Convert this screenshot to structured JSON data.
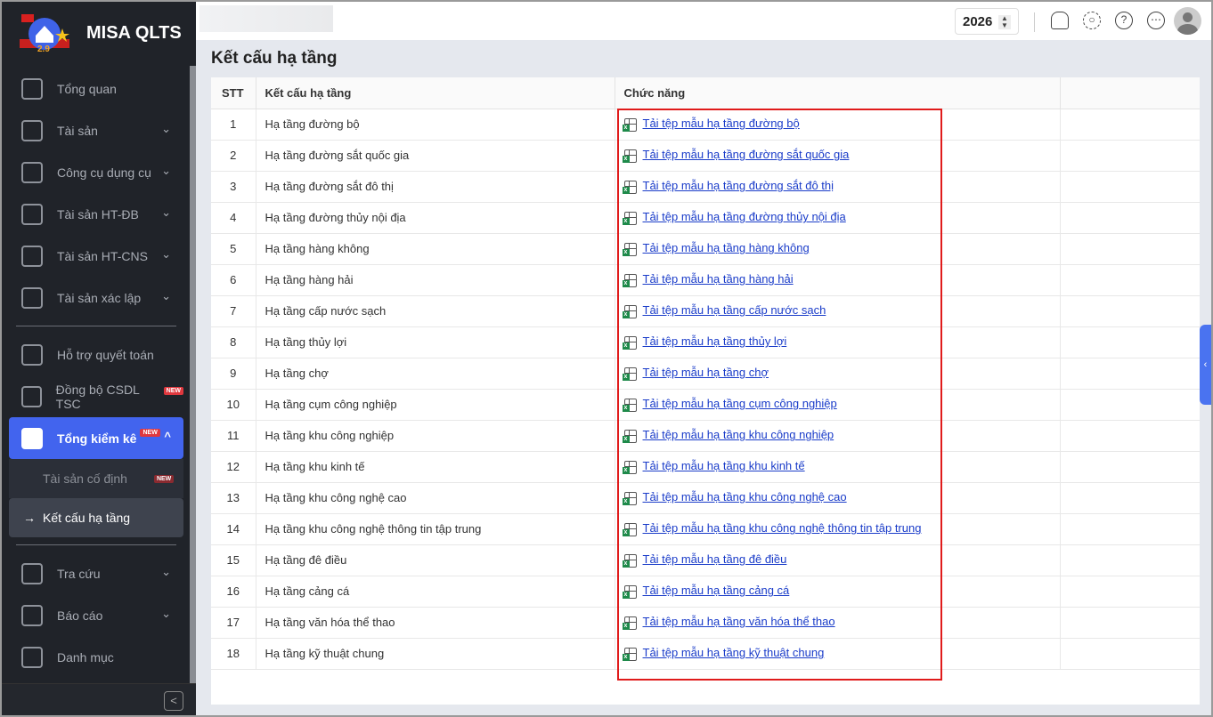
{
  "app": {
    "name": "MISA QLTS",
    "year": "2026"
  },
  "sidebar": {
    "items": [
      {
        "label": "Tổng quan",
        "chev": false
      },
      {
        "label": "Tài sản",
        "chev": true
      },
      {
        "label": "Công cụ dụng cụ",
        "chev": true
      },
      {
        "label": "Tài sản HT-ĐB",
        "chev": true
      },
      {
        "label": "Tài sản HT-CNS",
        "chev": true
      },
      {
        "label": "Tài sản xác lập",
        "chev": true
      }
    ],
    "items2": [
      {
        "label": "Hỗ trợ quyết toán"
      },
      {
        "label": "Đồng bộ CSDL TSC",
        "badge": "NEW"
      }
    ],
    "active": {
      "label": "Tổng kiểm kê",
      "badge": "NEW"
    },
    "sub": [
      {
        "label": "Tài sản cố định",
        "badge": "NEW"
      },
      {
        "label": "Kết cấu hạ tầng",
        "arrow": "→"
      }
    ],
    "items3": [
      {
        "label": "Tra cứu",
        "chev": true
      },
      {
        "label": "Báo cáo",
        "chev": true
      },
      {
        "label": "Danh mục",
        "chev": false
      }
    ]
  },
  "page": {
    "title": "Kết cấu hạ tầng"
  },
  "table": {
    "headers": [
      "STT",
      "Kết cấu hạ tầng",
      "Chức năng"
    ],
    "rows": [
      [
        "1",
        "Hạ tầng đường bộ",
        "Tải tệp mẫu hạ tầng đường bộ"
      ],
      [
        "2",
        "Hạ tầng đường sắt quốc gia",
        "Tải tệp mẫu hạ tầng đường sắt quốc gia"
      ],
      [
        "3",
        "Hạ tầng đường sắt đô thị",
        "Tải tệp mẫu hạ tầng đường sắt đô thị"
      ],
      [
        "4",
        "Hạ tầng đường thủy nội địa",
        "Tải tệp mẫu hạ tầng đường thủy nội địa"
      ],
      [
        "5",
        "Hạ tầng hàng không",
        "Tải tệp mẫu hạ tầng hàng không"
      ],
      [
        "6",
        "Hạ tầng hàng hải",
        "Tải tệp mẫu hạ tầng hàng hải"
      ],
      [
        "7",
        "Hạ tầng cấp nước sạch",
        "Tải tệp mẫu hạ tầng cấp nước sạch"
      ],
      [
        "8",
        "Hạ tầng thủy lợi",
        "Tải tệp mẫu hạ tầng thủy lợi"
      ],
      [
        "9",
        "Hạ tầng chợ",
        "Tải tệp mẫu hạ tầng chợ"
      ],
      [
        "10",
        "Hạ tầng cụm công nghiệp",
        "Tải tệp mẫu hạ tầng cụm công nghiệp"
      ],
      [
        "11",
        "Hạ tầng khu công nghiệp",
        "Tải tệp mẫu hạ tầng khu công nghiệp"
      ],
      [
        "12",
        "Hạ tầng khu kinh tế",
        "Tải tệp mẫu hạ tầng khu kinh tế"
      ],
      [
        "13",
        "Hạ tầng khu công nghệ cao",
        "Tải tệp mẫu hạ tầng khu công nghệ cao"
      ],
      [
        "14",
        "Hạ tầng khu công nghệ thông tin tập trung",
        "Tải tệp mẫu hạ tầng khu công nghệ thông tin tập trung"
      ],
      [
        "15",
        "Hạ tầng đê điều",
        "Tải tệp mẫu hạ tầng đê điều"
      ],
      [
        "16",
        "Hạ tầng cảng cá",
        "Tải tệp mẫu hạ tầng cảng cá"
      ],
      [
        "17",
        "Hạ tầng văn hóa thể thao",
        "Tải tệp mẫu hạ tầng văn hóa thể thao"
      ],
      [
        "18",
        "Hạ tầng kỹ thuật chung",
        "Tải tệp mẫu hạ tầng kỹ thuật chung"
      ]
    ]
  }
}
